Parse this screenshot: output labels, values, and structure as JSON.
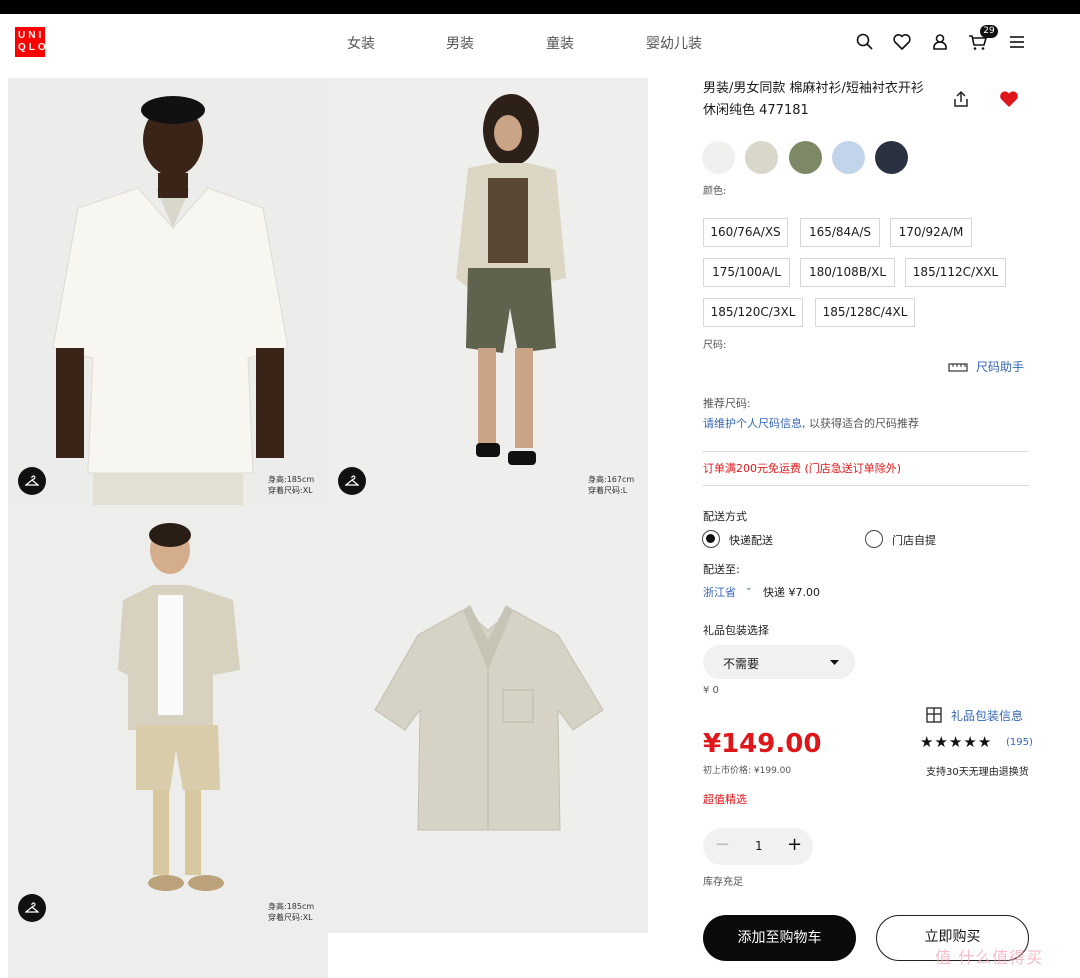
{
  "header": {
    "logo_lines": [
      "UNI",
      "QLO"
    ],
    "nav": [
      "女装",
      "男装",
      "童装",
      "婴幼儿装"
    ],
    "cart_count": "29",
    "icons": [
      "search-icon",
      "heart-icon",
      "user-icon",
      "cart-icon",
      "menu-icon"
    ]
  },
  "gallery": {
    "photos": [
      {
        "caption_height": "身高:185cm",
        "caption_size": "穿着尺码:XL"
      },
      {
        "caption_height": "身高:167cm",
        "caption_size": "穿着尺码:L"
      },
      {
        "caption_height": "身高:185cm",
        "caption_size": "穿着尺码:XL"
      }
    ]
  },
  "product": {
    "title": "男装/男女同款 棉麻衬衫/短袖衬衣开衫休闲纯色 477181",
    "swatches": [
      "#f0f0ee",
      "#d9d7ca",
      "#7d8866",
      "#c2d4ea",
      "#2b3140"
    ],
    "color_label": "颜色:",
    "sizes": [
      "160/76A/XS",
      "165/84A/S",
      "170/92A/M",
      "175/100A/L",
      "180/108B/XL",
      "185/112C/XXL",
      "185/120C/3XL",
      "185/128C/4XL"
    ],
    "size_label": "尺码:",
    "size_helper": "尺码助手",
    "recommend_label": "推荐尺码:",
    "recommend_link": "请维护个人尺码信息",
    "recommend_rest": ", 以获得适合的尺码推荐",
    "free_shipping": "订单满200元免运费 (门店急送订单除外)",
    "delivery_label": "配送方式",
    "delivery_options": [
      "快递配送",
      "门店自提"
    ],
    "ship_to_label": "配送至:",
    "province": "浙江省",
    "express_fee": "快递 ¥7.00",
    "gift_label": "礼品包装选择",
    "gift_value": "不需要",
    "gift_price": "¥ 0",
    "gift_info": "礼品包装信息",
    "price": "¥149.00",
    "original_price": "初上市价格: ¥199.00",
    "rating_stars": 5,
    "review_count": "(195)",
    "return_policy": "支持30天无理由退换货",
    "promo": "超值精选",
    "quantity": "1",
    "stock": "库存充足",
    "add_to_cart": "添加至购物车",
    "buy_now": "立即购买",
    "accent_red": "#e0171a",
    "link_blue": "#3466b4"
  },
  "watermark": "值 什么值得买"
}
